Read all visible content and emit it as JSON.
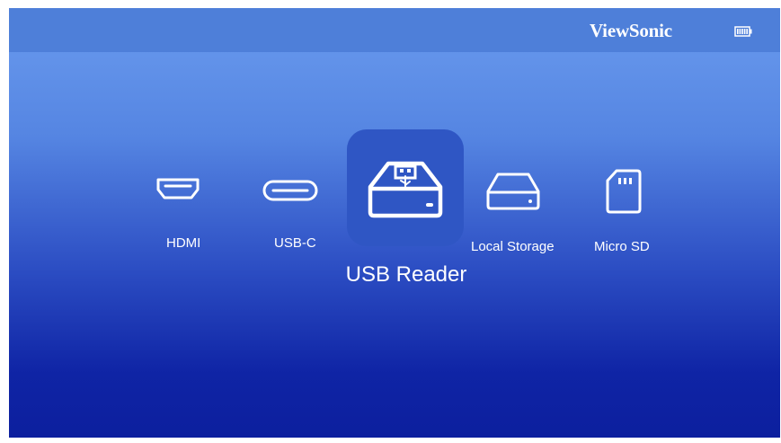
{
  "header": {
    "brand": "ViewSonic",
    "battery_icon": "battery-icon"
  },
  "sources": [
    {
      "label": "HDMI",
      "icon": "hdmi-icon"
    },
    {
      "label": "USB-C",
      "icon": "usb-c-icon"
    },
    {
      "label": "USB Reader",
      "icon": "usb-reader-icon",
      "selected": true
    },
    {
      "label": "Local Storage",
      "icon": "local-storage-icon"
    },
    {
      "label": "Micro SD",
      "icon": "micro-sd-icon"
    }
  ],
  "colors": {
    "background_top": "#6a9bee",
    "background_bottom": "#0c1f9e",
    "topbar": "#4e7fd9",
    "selected_tile": "#2f56c4",
    "text": "#ffffff"
  }
}
